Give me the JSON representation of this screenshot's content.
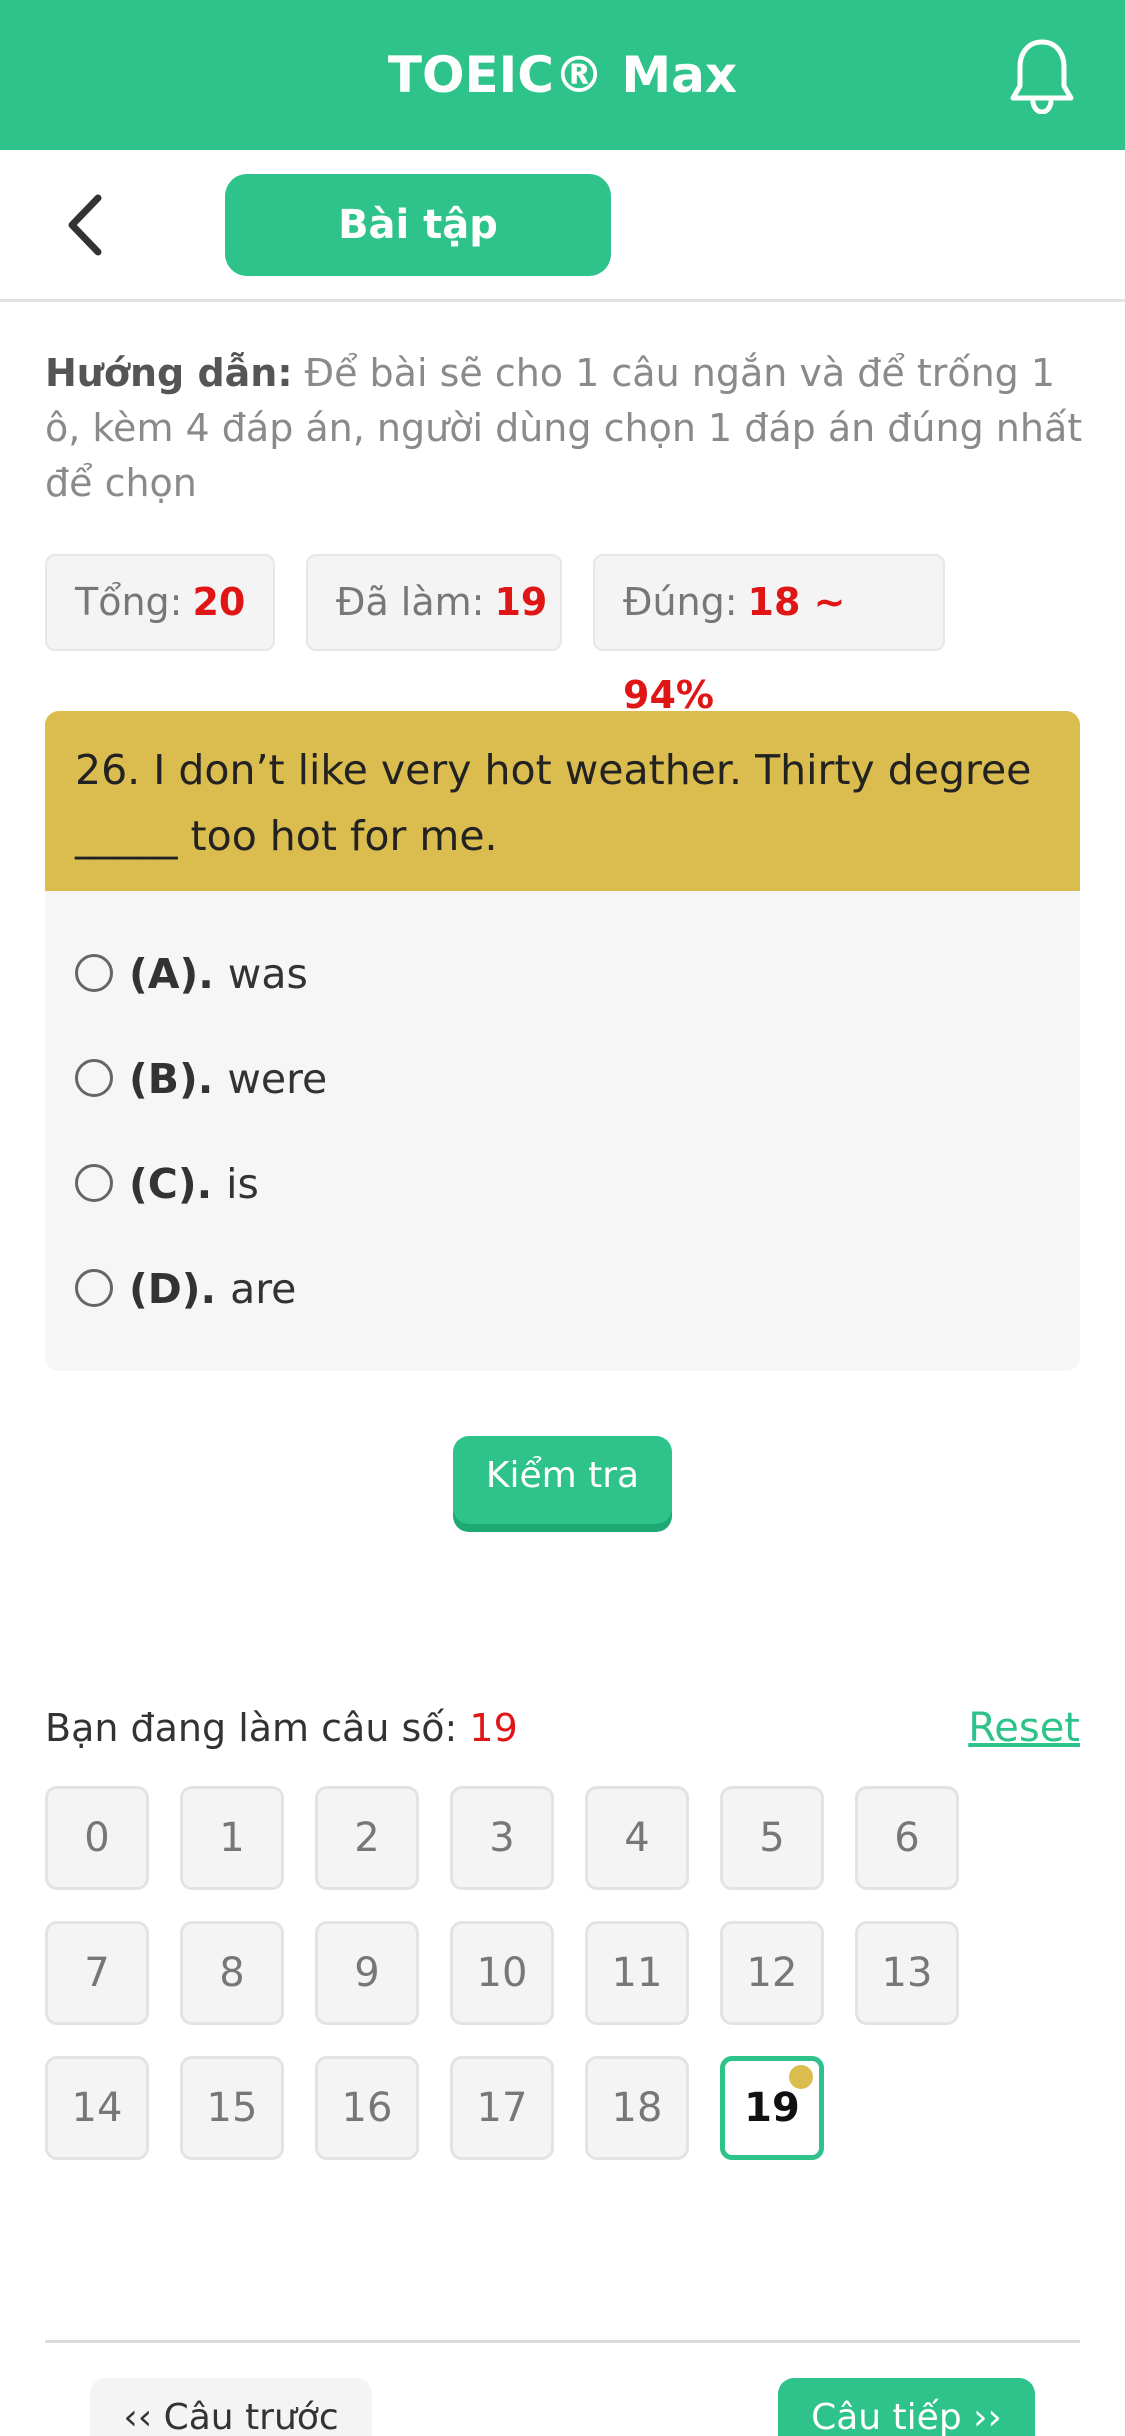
{
  "header": {
    "title": "TOEIC® Max",
    "bell_icon": "bell-icon",
    "accent": "#2ec38a"
  },
  "subbar": {
    "back_icon": "chevron-left-icon",
    "tab_label": "Bài tập"
  },
  "guide": {
    "label": "Hướng dẫn:",
    "text": " Để bài sẽ cho 1 câu ngắn và để trống 1 ô, kèm 4 đáp án, người dùng chọn 1 đáp án đúng nhất để chọn"
  },
  "stats": {
    "total_label": "Tổng:",
    "total_value": "20",
    "done_label": "Đã làm:",
    "done_value": "19",
    "correct_label": "Đúng:",
    "correct_value": "18 ~ 94%"
  },
  "question": {
    "text": "26. I don’t like very hot weather. Thirty degree _____ too hot for me.",
    "options": [
      {
        "letter": "(A).",
        "text": "was"
      },
      {
        "letter": "(B).",
        "text": "were"
      },
      {
        "letter": "(C).",
        "text": "is"
      },
      {
        "letter": "(D).",
        "text": "are"
      }
    ]
  },
  "check_label": "Kiểm tra",
  "progress": {
    "label": "Bạn đang làm câu số: ",
    "current": "19",
    "reset_label": "Reset"
  },
  "grid": [
    "0",
    "1",
    "2",
    "3",
    "4",
    "5",
    "6",
    "7",
    "8",
    "9",
    "10",
    "11",
    "12",
    "13",
    "14",
    "15",
    "16",
    "17",
    "18",
    "19"
  ],
  "nav": {
    "prev_label": "‹‹ Câu trước",
    "next_label": "Câu tiếp ››"
  }
}
